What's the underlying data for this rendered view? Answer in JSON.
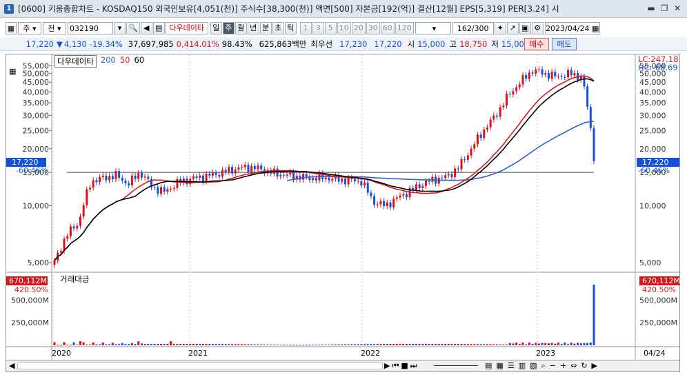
{
  "window": {
    "badge": "1",
    "title": "[0600] 키움종합차트 - KOSDAQ150 외국인보유[4,051(천)] 주식수[38,300(천)] 액면[500] 자본금[192(억)] 결산[12월] EPS[5,319] PER[3.24] 시"
  },
  "toolbar": {
    "type_select": "주",
    "market_select": "전",
    "code": "032190",
    "stock_name": "다우데이타",
    "periods": [
      "일",
      "주",
      "월",
      "년",
      "분",
      "초",
      "틱"
    ],
    "selected_period": "주",
    "intervals": [
      "1",
      "3",
      "5",
      "10",
      "20",
      "30",
      "60",
      "120"
    ],
    "count": "162",
    "count_total": "/300",
    "date": "2023/04/24"
  },
  "price": {
    "current": "17,220",
    "change": "4,130",
    "change_pct": "-19.34%",
    "volume": "37,697,985",
    "turnover": "0,414.01%",
    "ratio": "98.43%",
    "amount": "625,863백만",
    "best_ask_label": "최우선",
    "best_ask": "17,230",
    "best_bid": "17,220",
    "open_label": "시",
    "open": "15,000",
    "high_label": "고",
    "high": "18,750",
    "low_label": "저",
    "low": "15,000",
    "buy_label": "매수",
    "sell_label": "매도"
  },
  "chart_legend": {
    "name": "다우데이타",
    "ma1": "200",
    "ma2": "50",
    "ma3": "60"
  },
  "colors": {
    "up": "#e0101a",
    "down": "#1550d8",
    "ma200": "#2b5fd8",
    "ma50": "#d81818",
    "ma60": "#000000",
    "hline": "#6b6b6b"
  },
  "chart_data": [
    {
      "type": "candlestick",
      "title": "다우데이타",
      "y_scale": "log",
      "y_ticks": [
        "55,000",
        "50,000",
        "45,000",
        "40,000",
        "35,000",
        "30,000",
        "25,000",
        "20,000",
        "15,000",
        "10,000",
        "5,000"
      ],
      "x_ticks": [
        "2020",
        "2021",
        "2022",
        "2023"
      ],
      "right_info": {
        "lc": "LC:247.18",
        "hc": "HC:-68.69"
      },
      "current_marker": {
        "value": "17,220",
        "pct": "-60.46%"
      },
      "weekly_close_trend": [
        5000,
        7000,
        8200,
        13500,
        14000,
        14500,
        13000,
        15000,
        12500,
        11800,
        13200,
        13800,
        14200,
        14600,
        15200,
        15800,
        16000,
        15500,
        14800,
        14500,
        14200,
        14000,
        14100,
        13800,
        13600,
        13500,
        10500,
        10000,
        11000,
        12000,
        13000,
        13800,
        14200,
        16000,
        20000,
        25000,
        30000,
        38000,
        45000,
        52000,
        50000,
        48000,
        50000,
        48000,
        17220
      ],
      "moving_averages": [
        {
          "name": "200",
          "color": "#2b5fd8"
        },
        {
          "name": "50",
          "color": "#d81818"
        },
        {
          "name": "60",
          "color": "#000000"
        }
      ],
      "horizontal_line": 15000
    },
    {
      "type": "bar",
      "title": "거래대금",
      "y_ticks": [
        "500,000M",
        "250,000M"
      ],
      "last_value": "670,112M",
      "last_pct": "420.50%",
      "ylim": [
        0,
        700000
      ]
    }
  ],
  "axes": {
    "right_bottom_date": "04/24"
  }
}
